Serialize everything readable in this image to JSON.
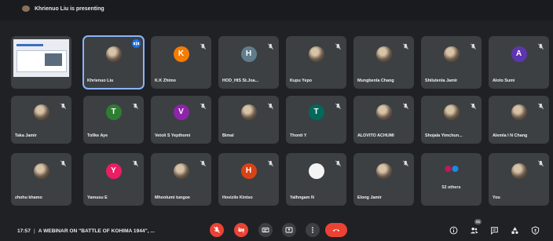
{
  "top": {
    "presenting": "Khrienuo Liu is presenting"
  },
  "tiles": [
    {
      "kind": "screen",
      "name": ""
    },
    {
      "kind": "photo",
      "name": "Khrienuo Liu",
      "active": true
    },
    {
      "kind": "letter",
      "letter": "K",
      "color": "#f57c00",
      "name": "K.K Zhimo"
    },
    {
      "kind": "letter",
      "letter": "H",
      "color": "#607d8b",
      "name": "HOD_HIS St.Joa..."
    },
    {
      "kind": "photo",
      "name": "Kupu Yepo"
    },
    {
      "kind": "photo",
      "name": "Mungbenla Chang"
    },
    {
      "kind": "photo",
      "name": "Shilulenla Jamir"
    },
    {
      "kind": "letter",
      "letter": "A",
      "color": "#5e35b1",
      "name": "Aloto Sumi"
    },
    {
      "kind": "photo",
      "name": "Taka Jamir"
    },
    {
      "kind": "letter",
      "letter": "T",
      "color": "#2e7d32",
      "name": "Tollke Aye"
    },
    {
      "kind": "letter",
      "letter": "V",
      "color": "#8e24aa",
      "name": "Vetoli S Yepthomi"
    },
    {
      "kind": "photo",
      "name": "Bimal"
    },
    {
      "kind": "letter",
      "letter": "T",
      "color": "#00695c",
      "name": "Thonti Y"
    },
    {
      "kind": "photo",
      "name": "ALOVITO ACHUMI"
    },
    {
      "kind": "photo",
      "name": "Shojala Yimchun..."
    },
    {
      "kind": "photo",
      "name": "Alemla I N Chang"
    },
    {
      "kind": "photo",
      "name": "zhohu khamo"
    },
    {
      "kind": "letter",
      "letter": "Y",
      "color": "#e91e63",
      "name": "Yamusu E"
    },
    {
      "kind": "photo",
      "name": "Mhonlumi tungoe"
    },
    {
      "kind": "letter",
      "letter": "H",
      "color": "#d84315",
      "name": "Hovizile Kintso"
    },
    {
      "kind": "white",
      "name": "Yalhngam N"
    },
    {
      "kind": "photo",
      "name": "Elong Jamir"
    },
    {
      "kind": "others",
      "name": "52 others"
    },
    {
      "kind": "photo",
      "name": "You"
    }
  ],
  "bottom": {
    "time": "17:57",
    "separator": "|",
    "meeting": "A WEBINAR ON \"BATTLE OF KOHIMA 1944\", ...",
    "participants_badge": "85"
  },
  "controls": [
    {
      "name": "mic-off-button",
      "icon": "mic-off-icon",
      "color": "red"
    },
    {
      "name": "camera-off-button",
      "icon": "camera-off-icon",
      "color": "red"
    },
    {
      "name": "captions-button",
      "icon": "captions-icon",
      "color": "grey"
    },
    {
      "name": "present-button",
      "icon": "present-icon",
      "color": "grey"
    },
    {
      "name": "more-options-button",
      "icon": "more-vert-icon",
      "color": "grey"
    },
    {
      "name": "end-call-button",
      "icon": "call-end-icon",
      "color": "end"
    }
  ],
  "right_icons": [
    "info-icon",
    "people-icon",
    "chat-icon",
    "activities-icon",
    "host-controls-icon"
  ]
}
